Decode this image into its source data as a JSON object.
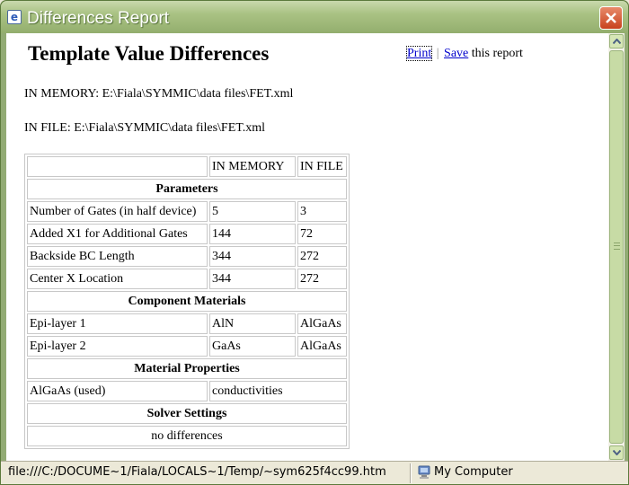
{
  "window": {
    "title": "Differences Report"
  },
  "page": {
    "heading": "Template Value Differences",
    "print_link": "Print",
    "separator": "|",
    "save_link": "Save",
    "actions_suffix": "this report",
    "in_memory_line": "IN MEMORY: E:\\Fiala\\SYMMIC\\data files\\FET.xml",
    "in_file_line": "IN FILE: E:\\Fiala\\SYMMIC\\data files\\FET.xml"
  },
  "table": {
    "headers": [
      "",
      "IN MEMORY",
      "IN FILE"
    ],
    "sections": [
      {
        "title": "Parameters",
        "rows": [
          [
            "Number of Gates (in half device)",
            "5",
            "3"
          ],
          [
            "Added X1 for Additional Gates",
            "144",
            "72"
          ],
          [
            "Backside BC Length",
            "344",
            "272"
          ],
          [
            "Center X Location",
            "344",
            "272"
          ]
        ]
      },
      {
        "title": "Component Materials",
        "rows": [
          [
            "Epi-layer 1",
            "AlN",
            "AlGaAs"
          ],
          [
            "Epi-layer 2",
            "GaAs",
            "AlGaAs"
          ]
        ]
      },
      {
        "title": "Material Properties",
        "rows": [
          [
            "AlGaAs (used)",
            "conductivities"
          ]
        ]
      },
      {
        "title": "Solver Settings",
        "note": "no differences"
      }
    ]
  },
  "statusbar": {
    "url": "file:///C:/DOCUME~1/Fiala/LOCALS~1/Temp/~sym625f4cc99.htm",
    "zone": "My Computer"
  }
}
